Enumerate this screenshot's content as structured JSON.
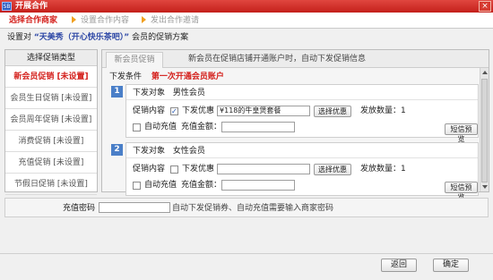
{
  "window": {
    "icon_text": "SB",
    "title": "开展合作",
    "close_label": "×"
  },
  "steps": [
    "选择合作商家",
    "设置合作内容",
    "发出合作邀请"
  ],
  "heading": {
    "prefix": "设置对",
    "shop": "“天美秀（开心快乐茶吧）”",
    "suffix": "会员的促销方案"
  },
  "left_panel": {
    "header": "选择促销类型",
    "items": [
      "新会员促销 [未设置]",
      "会员生日促销 [未设置]",
      "会员周年促销 [未设置]",
      "消费促销 [未设置]",
      "充值促销 [未设置]",
      "节假日促销 [未设置]"
    ]
  },
  "right_panel": {
    "tab": "新会员促销",
    "tab_note": "新会员在促销店铺开通账户时，自动下发促销信息",
    "condition_label": "下发条件",
    "condition_value": "第一次开通会员账户",
    "rules": [
      {
        "number": "1",
        "target_label": "下发对象",
        "target_value": "男性会员",
        "promo_label": "促销内容",
        "promo_checked": true,
        "coupon_label": "下发优惠",
        "coupon_value": "¥118的牛皇煲套餐",
        "select_btn": "选择优惠",
        "count_label": "发放数量：1",
        "recharge_checked": false,
        "recharge_label": "自动充值",
        "amount_label": "充值金额：",
        "amount_value": "",
        "sms_btn": "短信预览"
      },
      {
        "number": "2",
        "target_label": "下发对象",
        "target_value": "女性会员",
        "promo_label": "促销内容",
        "promo_checked": false,
        "coupon_label": "下发优惠",
        "coupon_value": "",
        "select_btn": "选择优惠",
        "count_label": "发放数量：1",
        "recharge_checked": false,
        "recharge_label": "自动充值",
        "amount_label": "充值金额：",
        "amount_value": "",
        "sms_btn": "短信预览"
      }
    ]
  },
  "password": {
    "label": "充值密码",
    "value": "",
    "hint": "自动下发促销券、自动充值需要输入商家密码"
  },
  "footer": {
    "back": "返回",
    "ok": "确定"
  }
}
